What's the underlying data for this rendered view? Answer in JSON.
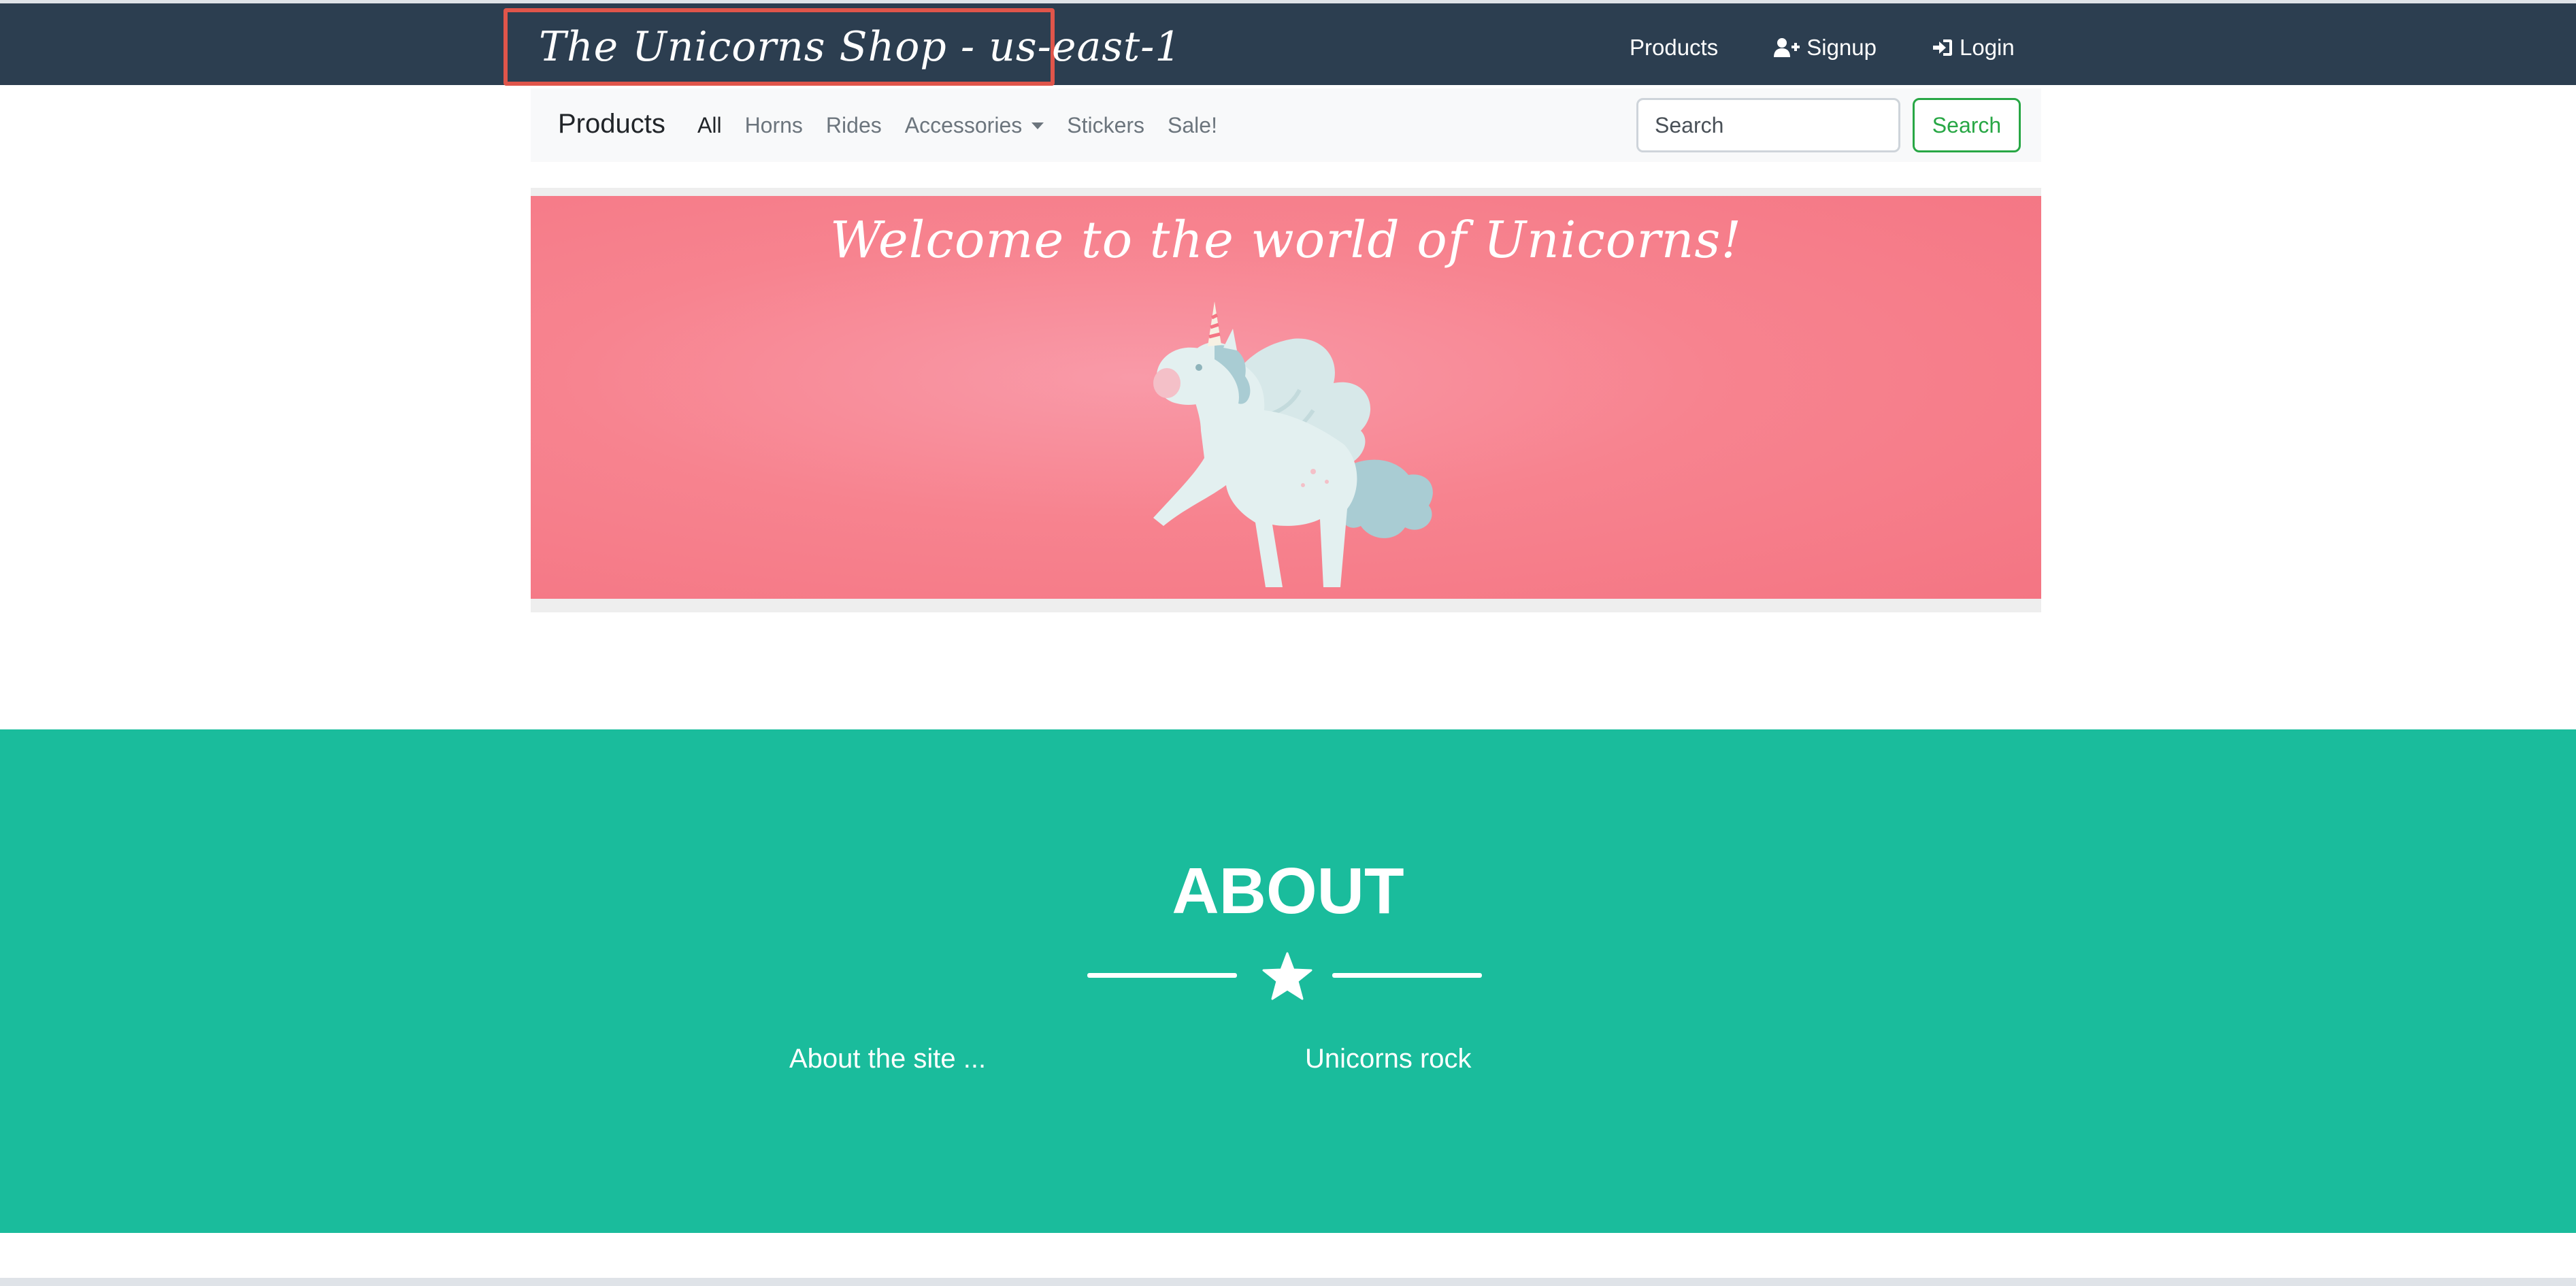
{
  "header": {
    "brand": "The Unicorns Shop - us-east-1",
    "links": [
      {
        "label": "Products",
        "icon": ""
      },
      {
        "label": "Signup",
        "icon": "user-plus-icon"
      },
      {
        "label": "Login",
        "icon": "sign-in-icon"
      }
    ]
  },
  "subnav": {
    "title": "Products",
    "links": [
      "All",
      "Horns",
      "Rides",
      "Accessories",
      "Stickers",
      "Sale!"
    ],
    "active": "All",
    "search_placeholder": "Search",
    "search_button": "Search"
  },
  "banner": {
    "title": "Welcome to the world of Unicorns!"
  },
  "about": {
    "title": "ABOUT",
    "left_text": "About the site ...",
    "right_text": "Unicorns rock"
  },
  "colors": {
    "header_bg": "#2c3e50",
    "about_bg": "#1abc9c",
    "banner_bg": "#f7838f",
    "search_green": "#28a745",
    "brand_highlight": "#e0554a"
  }
}
